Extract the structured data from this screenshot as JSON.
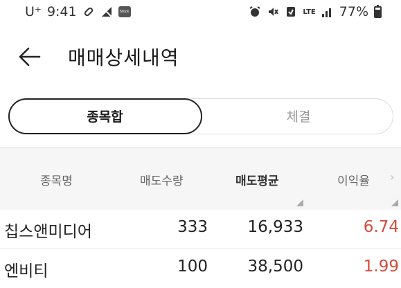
{
  "status_bar": {
    "carrier": "U⁺",
    "time": "9:41",
    "app_badge": "Stock",
    "network": "LTE",
    "battery": "77%"
  },
  "header": {
    "title": "매매상세내역"
  },
  "tabs": [
    {
      "label": "종목합",
      "active": true
    },
    {
      "label": "체결",
      "active": false
    }
  ],
  "table": {
    "columns": [
      "종목명",
      "매도수량",
      "매도평균",
      "이익율"
    ],
    "rows": [
      {
        "name": "칩스앤미디어",
        "qty": "333",
        "avg": "16,933",
        "rate": "6.74"
      },
      {
        "name": "엔비티",
        "qty": "100",
        "avg": "38,500",
        "rate": "1.99"
      }
    ]
  },
  "colors": {
    "profit_red": "#d64b3a",
    "header_bg": "#f6f6f6"
  }
}
